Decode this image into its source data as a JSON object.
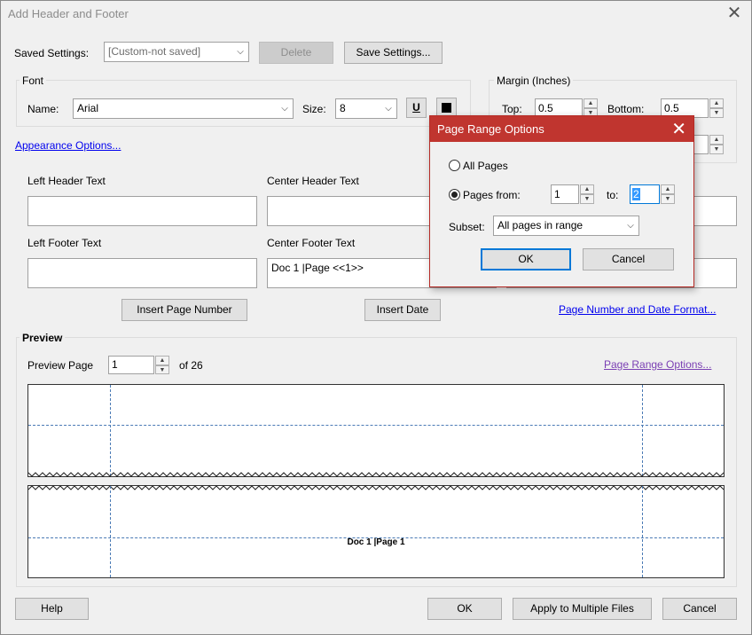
{
  "window": {
    "title": "Add Header and Footer",
    "close_glyph": "✕"
  },
  "saved_settings": {
    "label": "Saved Settings:",
    "value": "[Custom-not saved]",
    "delete_label": "Delete",
    "save_label": "Save Settings..."
  },
  "font": {
    "group_label": "Font",
    "name_label": "Name:",
    "name_value": "Arial",
    "size_label": "Size:",
    "size_value": "8",
    "underline_glyph": "U",
    "color": "#000000"
  },
  "margin": {
    "group_label": "Margin (Inches)",
    "top_label": "Top:",
    "top_value": "0.5",
    "bottom_label": "Bottom:",
    "bottom_value": "0.5"
  },
  "appearance_link": "Appearance Options...",
  "header_footer": {
    "left_header_label": "Left Header Text",
    "center_header_label": "Center Header Text",
    "left_footer_label": "Left Footer Text",
    "center_footer_label": "Center Footer Text",
    "left_header_value": "",
    "center_header_value": "",
    "right_header_value": "",
    "left_footer_value": "",
    "center_footer_value": "Doc 1 |Page <<1>>",
    "right_footer_value": ""
  },
  "insert_page_number_label": "Insert Page Number",
  "insert_date_label": "Insert Date",
  "page_number_format_link": "Page Number and Date Format...",
  "preview": {
    "group_label": "Preview",
    "page_label": "Preview Page",
    "page_value": "1",
    "of_label": "of 26",
    "range_link": "Page Range Options...",
    "footer_text": "Doc 1 |Page 1"
  },
  "bottom_buttons": {
    "help": "Help",
    "ok": "OK",
    "apply_multiple": "Apply to Multiple Files",
    "cancel": "Cancel"
  },
  "page_range_dialog": {
    "title": "Page Range Options",
    "close_glyph": "✕",
    "all_pages_label": "All Pages",
    "pages_from_label": "Pages from:",
    "from_value": "1",
    "to_label": "to:",
    "to_value": "2",
    "subset_label": "Subset:",
    "subset_value": "All pages in range",
    "ok_label": "OK",
    "cancel_label": "Cancel",
    "selected_option": "pages_from"
  },
  "colors": {
    "dialog_title_bar": "#c0352f",
    "link": "#0000ee",
    "visited_link": "#7a3fb3",
    "guide_lines": "#4a7ab5"
  }
}
